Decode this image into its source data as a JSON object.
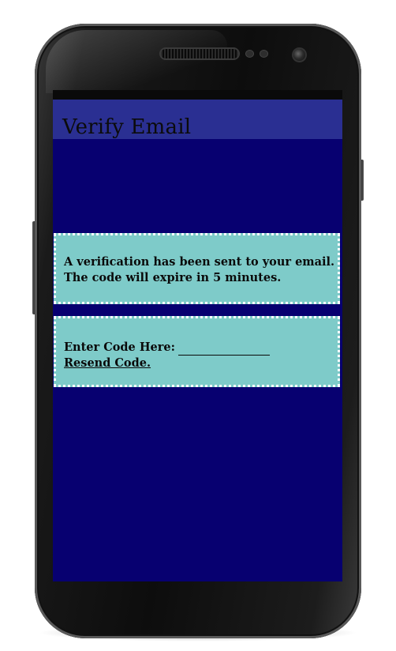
{
  "app_bar": {
    "title": "Verify Email"
  },
  "notice_card": {
    "line_1": "A verification has been sent to your email.",
    "line_2": "The code will expire in 5 minutes."
  },
  "code_card": {
    "label": "Enter Code Here:",
    "input_value": "",
    "resend_label": "Resend Code."
  },
  "colors": {
    "screen_background": "#070070",
    "app_bar": "#2a2f92",
    "card_background": "#7ecbc9",
    "card_border": "#ffffff",
    "text": "#0a0a0a"
  }
}
